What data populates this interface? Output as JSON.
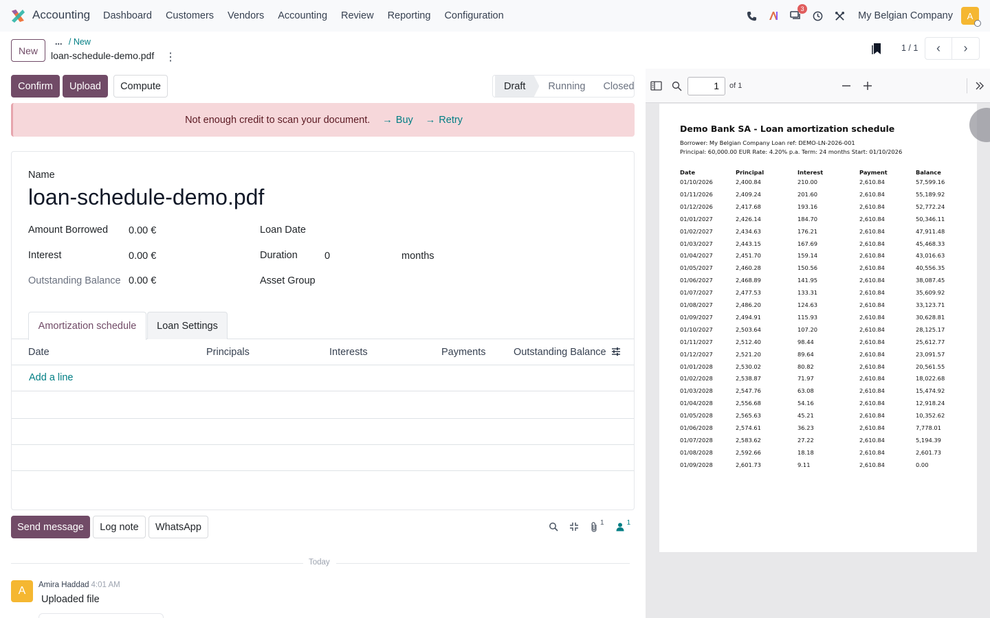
{
  "navbar": {
    "app_name": "Accounting",
    "menu": [
      "Dashboard",
      "Customers",
      "Vendors",
      "Accounting",
      "Review",
      "Reporting",
      "Configuration"
    ],
    "messages_badge": "3",
    "company": "My Belgian Company",
    "user_initial": "A"
  },
  "control": {
    "new_label": "New",
    "breadcrumb_dots": "...",
    "breadcrumb_current": "/ New",
    "record_title": "loan-schedule-demo.pdf",
    "record_menu": "⋮",
    "pager_value": "1 / 1"
  },
  "buttons": {
    "confirm": "Confirm",
    "upload": "Upload",
    "compute": "Compute"
  },
  "statusbar": {
    "draft": "Draft",
    "running": "Running",
    "closed": "Closed"
  },
  "alert": {
    "message": "Not enough credit to scan your document.",
    "buy": "Buy",
    "retry": "Retry"
  },
  "form": {
    "name_label": "Name",
    "name_value": "loan-schedule-demo.pdf",
    "amount_borrowed_label": "Amount Borrowed",
    "amount_borrowed": "0.00 €",
    "interest_label": "Interest",
    "interest": "0.00 €",
    "outstanding_label": "Outstanding Balance",
    "outstanding": "0.00 €",
    "loan_date_label": "Loan Date",
    "duration_label": "Duration",
    "duration_value": "0",
    "duration_unit": "months",
    "asset_group_label": "Asset Group"
  },
  "tabs": {
    "amortization": "Amortization schedule",
    "settings": "Loan Settings"
  },
  "table": {
    "headers": [
      "Date",
      "Principals",
      "Interests",
      "Payments",
      "Outstanding Balance"
    ],
    "add_line": "Add a line"
  },
  "chatter": {
    "send_message": "Send message",
    "log_note": "Log note",
    "whatsapp": "WhatsApp",
    "attachments_count": "1",
    "followers_count": "1",
    "today": "Today",
    "author": "Amira Haddad",
    "time": "4:01 AM",
    "body": "Uploaded file",
    "author_initial": "A"
  },
  "viewer": {
    "page_number": "1",
    "page_total": "of 1"
  },
  "pdf": {
    "title": "Demo Bank SA - Loan amortization schedule",
    "borrower_line": "Borrower: My Belgian Company   Loan ref: DEMO-LN-2026-001",
    "terms_line": "Principal: 60,000.00 EUR   Rate: 4.20% p.a.   Term: 24 months   Start: 01/10/2026",
    "headers": [
      "Date",
      "Principal",
      "Interest",
      "Payment",
      "Balance"
    ],
    "rows": [
      [
        "01/10/2026",
        "2,400.84",
        "210.00",
        "2,610.84",
        "57,599.16"
      ],
      [
        "01/11/2026",
        "2,409.24",
        "201.60",
        "2,610.84",
        "55,189.92"
      ],
      [
        "01/12/2026",
        "2,417.68",
        "193.16",
        "2,610.84",
        "52,772.24"
      ],
      [
        "01/01/2027",
        "2,426.14",
        "184.70",
        "2,610.84",
        "50,346.11"
      ],
      [
        "01/02/2027",
        "2,434.63",
        "176.21",
        "2,610.84",
        "47,911.48"
      ],
      [
        "01/03/2027",
        "2,443.15",
        "167.69",
        "2,610.84",
        "45,468.33"
      ],
      [
        "01/04/2027",
        "2,451.70",
        "159.14",
        "2,610.84",
        "43,016.63"
      ],
      [
        "01/05/2027",
        "2,460.28",
        "150.56",
        "2,610.84",
        "40,556.35"
      ],
      [
        "01/06/2027",
        "2,468.89",
        "141.95",
        "2,610.84",
        "38,087.45"
      ],
      [
        "01/07/2027",
        "2,477.53",
        "133.31",
        "2,610.84",
        "35,609.92"
      ],
      [
        "01/08/2027",
        "2,486.20",
        "124.63",
        "2,610.84",
        "33,123.71"
      ],
      [
        "01/09/2027",
        "2,494.91",
        "115.93",
        "2,610.84",
        "30,628.81"
      ],
      [
        "01/10/2027",
        "2,503.64",
        "107.20",
        "2,610.84",
        "28,125.17"
      ],
      [
        "01/11/2027",
        "2,512.40",
        "98.44",
        "2,610.84",
        "25,612.77"
      ],
      [
        "01/12/2027",
        "2,521.20",
        "89.64",
        "2,610.84",
        "23,091.57"
      ],
      [
        "01/01/2028",
        "2,530.02",
        "80.82",
        "2,610.84",
        "20,561.55"
      ],
      [
        "01/02/2028",
        "2,538.87",
        "71.97",
        "2,610.84",
        "18,022.68"
      ],
      [
        "01/03/2028",
        "2,547.76",
        "63.08",
        "2,610.84",
        "15,474.92"
      ],
      [
        "01/04/2028",
        "2,556.68",
        "54.16",
        "2,610.84",
        "12,918.24"
      ],
      [
        "01/05/2028",
        "2,565.63",
        "45.21",
        "2,610.84",
        "10,352.62"
      ],
      [
        "01/06/2028",
        "2,574.61",
        "36.23",
        "2,610.84",
        "7,778.01"
      ],
      [
        "01/07/2028",
        "2,583.62",
        "27.22",
        "2,610.84",
        "5,194.39"
      ],
      [
        "01/08/2028",
        "2,592.66",
        "18.18",
        "2,610.84",
        "2,601.73"
      ],
      [
        "01/09/2028",
        "2,601.73",
        "9.11",
        "2,610.84",
        "0.00"
      ]
    ]
  },
  "colors": {
    "primary": "#714b67",
    "link": "#017e84",
    "alert_bg": "#f6d7da",
    "avatar": "#f5b731"
  }
}
